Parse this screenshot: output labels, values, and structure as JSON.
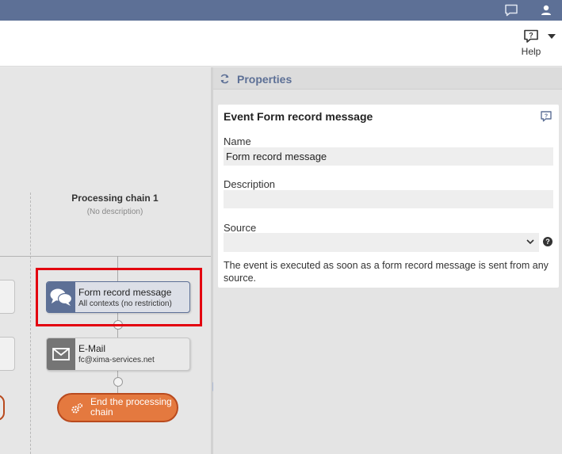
{
  "topbar": {
    "chat_icon": "chat-bubble-icon",
    "user_icon": "user-icon"
  },
  "toolbar": {
    "help_label": "Help"
  },
  "canvas": {
    "chain": {
      "title": "Processing chain 1",
      "description": "(No description)"
    },
    "nodes": {
      "form": {
        "title": "Form record message",
        "subtitle": "All contexts (no restriction)"
      },
      "mail": {
        "title": "E-Mail",
        "subtitle": "fc@xima-services.net"
      },
      "end": {
        "label_line1": "End the processing",
        "label_line2": "chain"
      }
    }
  },
  "properties": {
    "header_title": "Properties",
    "card_title": "Event Form record message",
    "fields": {
      "name_label": "Name",
      "name_value": "Form record message",
      "description_label": "Description",
      "description_value": "",
      "source_label": "Source",
      "source_value": ""
    },
    "info_text": "The event is executed as soon as a form record message is sent from any source."
  },
  "colors": {
    "brand": "#5d7096",
    "highlight": "#e3000f",
    "end_node": "#e4793f"
  }
}
